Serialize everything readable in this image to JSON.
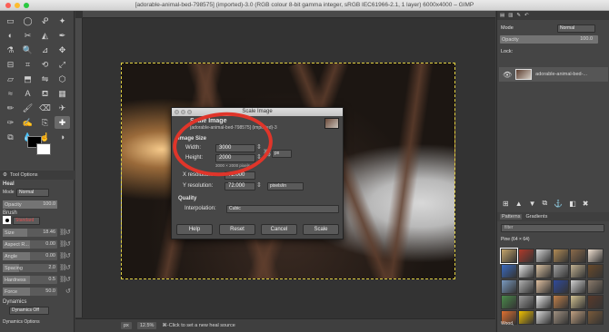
{
  "window": {
    "title": "[adorable-animal-bed-798575] (imported)-3.0 (RGB colour 8-bit gamma integer, sRGB IEC61966-2.1, 1 layer) 6000x4000 – GIMP",
    "traffic_light_colors": [
      "#fc5f57",
      "#fdbc2e",
      "#29c840"
    ]
  },
  "toolbox": {
    "tools": [
      "rect-select",
      "ellipse-select",
      "free-select",
      "fuzzy-select",
      "by-color-select",
      "scissors",
      "foreground-select",
      "paths",
      "color-picker",
      "zoom",
      "measure",
      "move",
      "align",
      "crop",
      "rotate",
      "scale",
      "shear",
      "perspective",
      "flip",
      "cage",
      "warp",
      "text",
      "bucket-fill",
      "blend",
      "pencil",
      "paintbrush",
      "eraser",
      "airbrush",
      "ink",
      "mypaint-brush",
      "clone",
      "heal",
      "perspective-clone",
      "blur",
      "smudge",
      "dodge-burn"
    ],
    "active_tool": "heal",
    "foreground_color": "#000000",
    "background_color": "#ffffff",
    "tab_tool_options": "Tool Options",
    "heading": "Heal",
    "mode_label": "Mode",
    "mode_value": "Normal",
    "opacity": {
      "label": "Opacity",
      "value": "100.0",
      "fraction": 1.0
    },
    "brush_label": "Brush",
    "brush_name": "Standard",
    "size": {
      "label": "Size",
      "value": "18.46",
      "fraction": 0.45
    },
    "aspect_ratio": {
      "label": "Aspect R...",
      "value": "0.00",
      "fraction": 0.5
    },
    "angle": {
      "label": "Angle",
      "value": "0.00",
      "fraction": 0.5
    },
    "spacing": {
      "label": "Spacing",
      "value": "2.0",
      "fraction": 0.3
    },
    "hardness": {
      "label": "Hardness",
      "value": "0.5",
      "fraction": 0.5
    },
    "force": {
      "label": "Force",
      "value": "50.0",
      "fraction": 0.5
    },
    "dynamics_label": "Dynamics",
    "dynamics_value": "Dynamics Off",
    "dynamics_options_label": "Dynamics Options"
  },
  "statusbar": {
    "unit": "px",
    "zoom": "12.5%",
    "message": "⌘-Click to set a new heal source"
  },
  "dialog": {
    "title": "Scale Image",
    "heading": "Scale Image",
    "subtitle": "[adorable-animal-bed-798575] (imported)-3",
    "section_image_size": "Image Size",
    "width_label": "Width:",
    "width_value": "3000",
    "height_label": "Height:",
    "height_value": "2000",
    "size_note": "3000 × 2000 pixels",
    "unit_value": "px",
    "x_res_label": "X resolution:",
    "x_res_value": "72.000",
    "y_res_label": "Y resolution:",
    "y_res_value": "72.000",
    "res_unit": "pixels/in",
    "section_quality": "Quality",
    "interpolation_label": "Interpolation:",
    "interpolation_value": "Cubic",
    "buttons": {
      "help": "Help",
      "reset": "Reset",
      "cancel": "Cancel",
      "scale": "Scale"
    },
    "highlight_color": "#e0352a"
  },
  "dock": {
    "mode_label": "Mode",
    "mode_value": "Normal",
    "opacity_label": "Opacity",
    "opacity_value": "100.0",
    "lock_label": "Lock:",
    "layer_name": "adorable-animal-bed-...",
    "tabs_bottom": [
      "Patterns",
      "Gradients"
    ],
    "filter_label": "filter",
    "pattern_title": "Pine (64 × 64)",
    "pattern_name": "Wood,",
    "pattern_colors": [
      "#c5a56a",
      "#b03a2a",
      "#d2d2d2",
      "#b08a55",
      "#8a6a4a",
      "#f0e0d0",
      "#3a6ac0",
      "#e6e6e6",
      "#d8c0a0",
      "#a0a0a0",
      "#c0b090",
      "#6a4a2a",
      "#7a9ac0",
      "#b0b0b0",
      "#e0c0a0",
      "#304a9a",
      "#d0d0d0",
      "#8a7a6a",
      "#4a8a4a",
      "#9a9a9a",
      "#e8e8e8",
      "#c0804a",
      "#d0c090",
      "#5a3a2a",
      "#e07030",
      "#f0c000",
      "#d8d8d8",
      "#a09080",
      "#c0a080",
      "#7a5a3a"
    ]
  }
}
